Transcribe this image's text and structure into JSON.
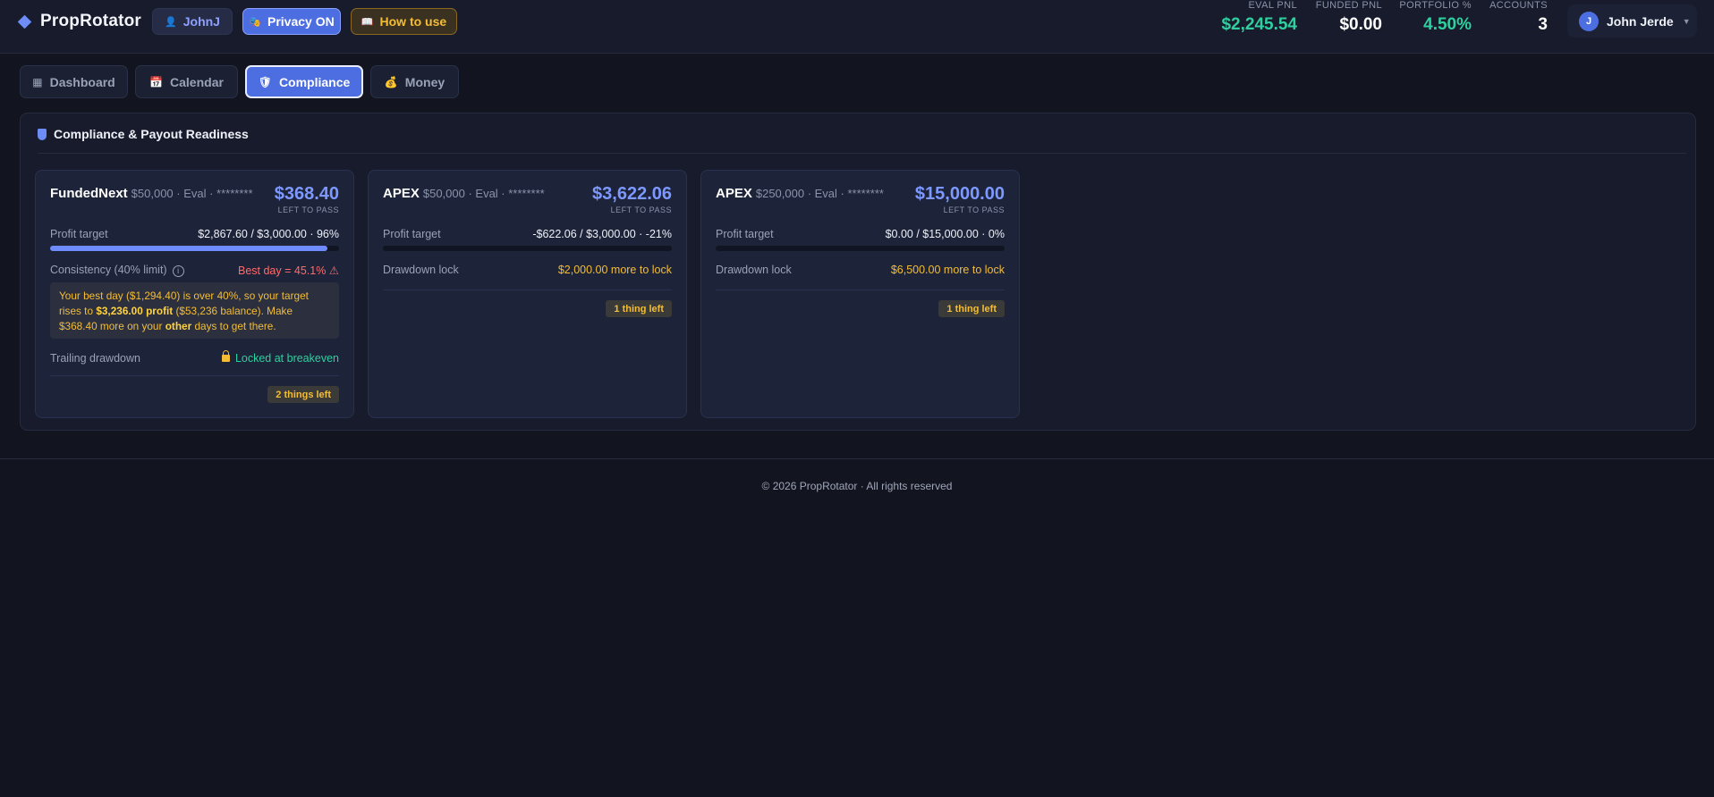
{
  "header": {
    "brand": "PropRotator",
    "user_pill": "JohnJ",
    "privacy_pill": "Privacy ON",
    "howto_pill": "How to use",
    "stats": [
      {
        "label": "EVAL PNL",
        "value": "$2,245.54",
        "color": "#2fd0a0"
      },
      {
        "label": "FUNDED PNL",
        "value": "$0.00",
        "color": "#ffffff"
      },
      {
        "label": "PORTFOLIO %",
        "value": "4.50%",
        "color": "#2fd0a0"
      },
      {
        "label": "ACCOUNTS",
        "value": "3",
        "color": "#ffffff"
      }
    ],
    "user_menu": {
      "initial": "J",
      "name": "John Jerde"
    }
  },
  "tabs": [
    {
      "label": "Dashboard",
      "icon": "grid-icon",
      "active": false
    },
    {
      "label": "Calendar",
      "icon": "calendar-icon",
      "active": false
    },
    {
      "label": "Compliance",
      "icon": "shield-icon",
      "active": true
    },
    {
      "label": "Money",
      "icon": "money-bag-icon",
      "active": false
    }
  ],
  "panel": {
    "title": "Compliance & Payout Readiness",
    "cards": [
      {
        "firm": "FundedNext",
        "meta": "$50,000 · Eval · ********",
        "amount": "$368.40",
        "amount_sub": "LEFT TO PASS",
        "profit_label": "Profit target",
        "profit_value": "$2,867.60 / $3,000.00 · 96%",
        "progress": 0.96,
        "consistency_label": "Consistency (40% limit)",
        "consistency_value": "Best day = 45.1% ⚠",
        "warning_text_1": "Your best day ($1,294.40) is over 40%, so your target rises to ",
        "warning_bold_1": "$3,236.00 profit",
        "warning_text_2": " ($53,236 balance). Make $368.40 more on your ",
        "warning_bold_2": "other",
        "warning_text_3": " days to get there.",
        "trailing_label": "Trailing drawdown",
        "trailing_value": "Locked at breakeven",
        "badge": "2 things left"
      },
      {
        "firm": "APEX",
        "meta": "$50,000 · Eval · ********",
        "amount": "$3,622.06",
        "amount_sub": "LEFT TO PASS",
        "profit_label": "Profit target",
        "profit_value": "-$622.06 / $3,000.00 · -21%",
        "progress": 0,
        "drawdown_label": "Drawdown lock",
        "drawdown_value": "$2,000.00 more to lock",
        "badge": "1 thing left"
      },
      {
        "firm": "APEX",
        "meta": "$250,000 · Eval · ********",
        "amount": "$15,000.00",
        "amount_sub": "LEFT TO PASS",
        "profit_label": "Profit target",
        "profit_value": "$0.00 / $15,000.00 · 0%",
        "progress": 0,
        "drawdown_label": "Drawdown lock",
        "drawdown_value": "$6,500.00 more to lock",
        "badge": "1 thing left"
      }
    ]
  },
  "footer": "© 2026 PropRotator · All rights reserved"
}
